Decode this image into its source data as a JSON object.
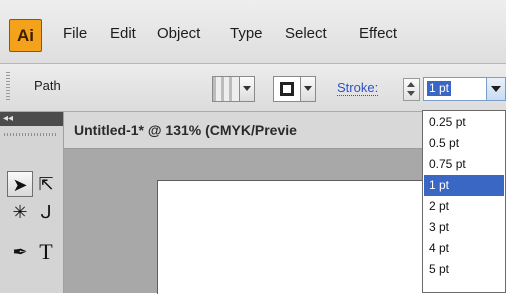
{
  "app": {
    "logo": "Ai"
  },
  "menu": [
    "File",
    "Edit",
    "Object",
    "Type",
    "Select",
    "Effect"
  ],
  "control_bar": {
    "selection_label": "Path",
    "stroke_link": "Stroke:",
    "stroke_weight": "1 pt"
  },
  "document": {
    "tab_title": "Untitled-1* @ 131% (CMYK/Previe"
  },
  "stroke_options": [
    "0.25 pt",
    "0.5 pt",
    "0.75 pt",
    "1 pt",
    "2 pt",
    "3 pt",
    "4 pt",
    "5 pt"
  ],
  "selected_option": "1 pt",
  "tools": [
    {
      "name": "selection-tool-icon",
      "glyph": "➤"
    },
    {
      "name": "direct-selection-tool-icon",
      "glyph": "⇱"
    },
    {
      "name": "magic-wand-tool-icon",
      "glyph": "✳"
    },
    {
      "name": "lasso-tool-icon",
      "glyph": "ᒍ"
    },
    {
      "name": "pen-tool-icon",
      "glyph": "✒"
    },
    {
      "name": "type-tool-icon",
      "glyph": "T"
    }
  ],
  "colors": {
    "accent": "#3a66c4",
    "logo": "#f4a11c",
    "stroke_link": "#2f51c8"
  }
}
